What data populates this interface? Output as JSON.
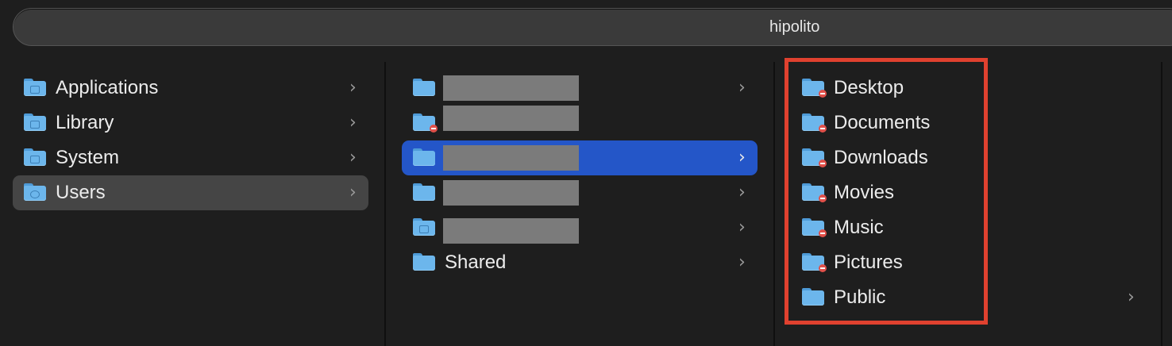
{
  "path_bar": {
    "title": "hipolito"
  },
  "column1": {
    "items": [
      {
        "label": "Applications",
        "icon": "folder-applications-icon",
        "has_children": true
      },
      {
        "label": "Library",
        "icon": "folder-library-icon",
        "has_children": true
      },
      {
        "label": "System",
        "icon": "folder-system-icon",
        "has_children": true
      },
      {
        "label": "Users",
        "icon": "folder-users-icon",
        "has_children": true,
        "selected": true
      }
    ]
  },
  "column2": {
    "items": [
      {
        "label": "",
        "redacted": true
      },
      {
        "label": "",
        "redacted": true,
        "restricted": true
      },
      {
        "label": "",
        "redacted": true,
        "selected": true
      },
      {
        "label": "",
        "redacted": true
      },
      {
        "label": "",
        "redacted": true,
        "icon": "home-folder-icon"
      },
      {
        "label": "Shared"
      }
    ]
  },
  "column3": {
    "items": [
      {
        "label": "Desktop",
        "restricted": true
      },
      {
        "label": "Documents",
        "restricted": true
      },
      {
        "label": "Downloads",
        "restricted": true
      },
      {
        "label": "Movies",
        "restricted": true
      },
      {
        "label": "Music",
        "restricted": true
      },
      {
        "label": "Pictures",
        "restricted": true
      },
      {
        "label": "Public",
        "has_children": true
      }
    ]
  },
  "colors": {
    "selection_blue": "#2456c8",
    "highlight_red": "#e0412f",
    "folder_blue": "#6cb6ec"
  }
}
